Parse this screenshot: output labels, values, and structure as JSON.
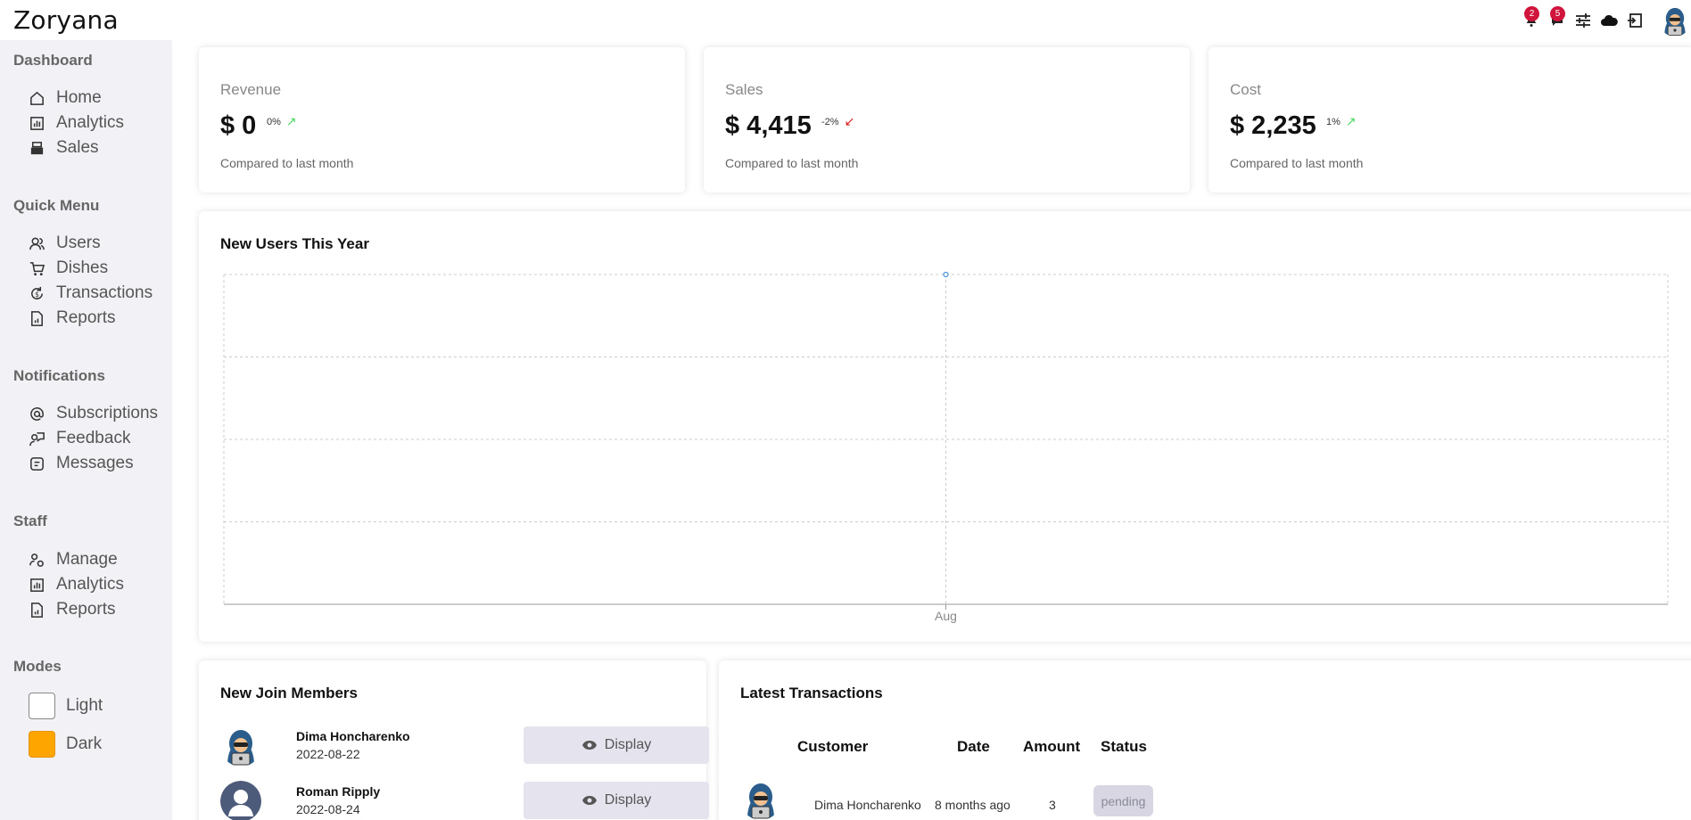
{
  "brand": "Zoryana",
  "topbar": {
    "notification_count": "2",
    "message_count": "5",
    "icons": [
      "bell-icon",
      "chat-icon",
      "sliders-icon",
      "cloud-icon",
      "logout-icon"
    ]
  },
  "sidebar": {
    "sections": [
      {
        "title": "Dashboard",
        "items": [
          {
            "label": "Home",
            "icon": "home-icon"
          },
          {
            "label": "Analytics",
            "icon": "analytics-icon"
          },
          {
            "label": "Sales",
            "icon": "cash-register-icon"
          }
        ]
      },
      {
        "title": "Quick Menu",
        "items": [
          {
            "label": "Users",
            "icon": "users-icon"
          },
          {
            "label": "Dishes",
            "icon": "cart-icon"
          },
          {
            "label": "Transactions",
            "icon": "transactions-icon"
          },
          {
            "label": "Reports",
            "icon": "report-icon"
          }
        ]
      },
      {
        "title": "Notifications",
        "items": [
          {
            "label": "Subscriptions",
            "icon": "at-icon"
          },
          {
            "label": "Feedback",
            "icon": "feedback-icon"
          },
          {
            "label": "Messages",
            "icon": "message-icon"
          }
        ]
      },
      {
        "title": "Staff",
        "items": [
          {
            "label": "Manage",
            "icon": "manage-icon"
          },
          {
            "label": "Analytics",
            "icon": "analytics-icon"
          },
          {
            "label": "Reports",
            "icon": "report-icon"
          }
        ]
      }
    ],
    "modes_title": "Modes",
    "modes": [
      {
        "label": "Light",
        "color": "#ffffff"
      },
      {
        "label": "Dark",
        "color": "#ffa500"
      }
    ]
  },
  "kpis": [
    {
      "title": "Revenue",
      "value": "$ 0",
      "rate": "0%",
      "trend": "up",
      "note": "Compared to last month"
    },
    {
      "title": "Sales",
      "value": "$ 4,415",
      "rate": "-2%",
      "trend": "down",
      "note": "Compared to last month"
    },
    {
      "title": "Cost",
      "value": "$ 2,235",
      "rate": "1%",
      "trend": "up",
      "note": "Compared to last month"
    }
  ],
  "colors": {
    "up": "#4cd964",
    "down": "#e02020",
    "line": "#4a90d9"
  },
  "chart_title": "New Users This Year",
  "chart_data": {
    "type": "line",
    "categories": [
      "Aug"
    ],
    "series": [
      {
        "values": [
          4
        ]
      }
    ],
    "title": "New Users This Year",
    "ylim": [
      0,
      4
    ],
    "grid": true
  },
  "members": {
    "title": "New Join Members",
    "button_label": "Display",
    "items": [
      {
        "name": "Dima Honcharenko",
        "date": "2022-08-22",
        "avatar": "hacker-avatar"
      },
      {
        "name": "Roman Ripply",
        "date": "2022-08-24",
        "avatar": "default-avatar"
      }
    ]
  },
  "transactions": {
    "title": "Latest Transactions",
    "headers": [
      "Customer",
      "Date",
      "Amount",
      "Status"
    ],
    "rows": [
      {
        "customer": "Dima Honcharenko",
        "date": "8 months ago",
        "amount": "3",
        "status": "pending"
      }
    ]
  }
}
